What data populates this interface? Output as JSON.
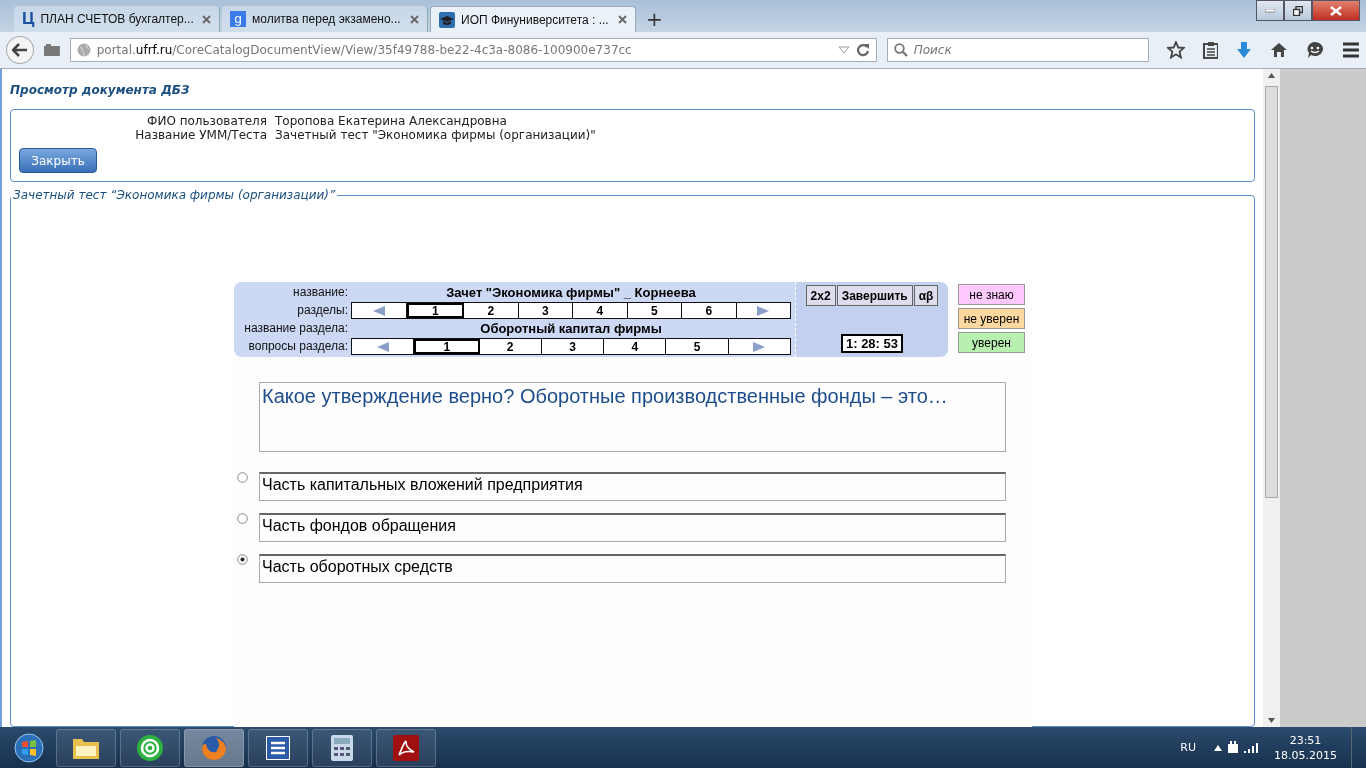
{
  "browser": {
    "tabs": [
      {
        "kind": "letter",
        "favicon_text": "Ц",
        "title": "ПЛАН СЧЕТОВ бухгалтер...",
        "selected": false
      },
      {
        "kind": "letter-box",
        "favicon_text": "g",
        "title": "молитва перед экзамено...",
        "selected": false
      },
      {
        "kind": "cap",
        "title": "ИОП Финуниверситета : ...",
        "selected": true
      }
    ],
    "new_tab": "+",
    "url": {
      "prefix": "portal.",
      "domain": "ufrf.ru",
      "path": "/CoreCatalogDocumentView/View/35f49788-be22-4c3a-8086-100900e737cc"
    },
    "search": {
      "placeholder": "Поиск"
    }
  },
  "page": {
    "title": "Просмотр документа ДБЗ",
    "info": [
      {
        "label": "ФИО пользователя",
        "value": "Торопова Екатерина Александровна"
      },
      {
        "label": "Название УММ/Теста",
        "value": "Зачетный тест \"Экономика фирмы (организации)\""
      }
    ],
    "close_button": "Закрыть",
    "legend": "Зачетный тест “Экономика фирмы (организации)”",
    "test": {
      "name_label": "название:",
      "name": "Зачет \"Экономика фирмы\" _ Корнеева",
      "sections_label": "разделы:",
      "sections": [
        {
          "label": "1",
          "selected": true
        },
        {
          "label": "2",
          "selected": false
        },
        {
          "label": "3",
          "selected": false
        },
        {
          "label": "4",
          "selected": false
        },
        {
          "label": "5",
          "selected": false
        },
        {
          "label": "6",
          "selected": false
        }
      ],
      "section_name_label": "название раздела:",
      "section_name": "Оборотный капитал фирмы",
      "questions_label": "вопросы раздела:",
      "questions": [
        {
          "label": "1",
          "selected": true
        },
        {
          "label": "2",
          "selected": false
        },
        {
          "label": "3",
          "selected": false
        },
        {
          "label": "4",
          "selected": false
        },
        {
          "label": "5",
          "selected": false
        }
      ],
      "tool_buttons": [
        "2x2",
        "Завершить",
        "αβ"
      ],
      "timer": "1: 28: 53",
      "confidence": [
        {
          "label": "не знаю",
          "color": "#ffc8ff"
        },
        {
          "label": "не уверен",
          "color": "#ffd8a0"
        },
        {
          "label": "уверен",
          "color": "#b8f0b0"
        }
      ]
    },
    "question": {
      "text": "Какое утверждение верно? Оборотные производственные фонды – это…",
      "options": [
        {
          "text": "Часть капитальных вложений предприятия",
          "selected": false
        },
        {
          "text": "Часть фондов обращения",
          "selected": false
        },
        {
          "text": "Часть оборотных средств",
          "selected": true
        }
      ]
    }
  },
  "taskbar": {
    "apps": [
      {
        "kind": "folder",
        "active": false
      },
      {
        "kind": "mail",
        "active": false
      },
      {
        "kind": "firefox",
        "active": true
      },
      {
        "kind": "word",
        "active": false
      },
      {
        "kind": "calculator",
        "active": false
      },
      {
        "kind": "pdf",
        "active": false
      }
    ],
    "language": "RU",
    "time": "23:51",
    "date": "18.05.2015"
  }
}
